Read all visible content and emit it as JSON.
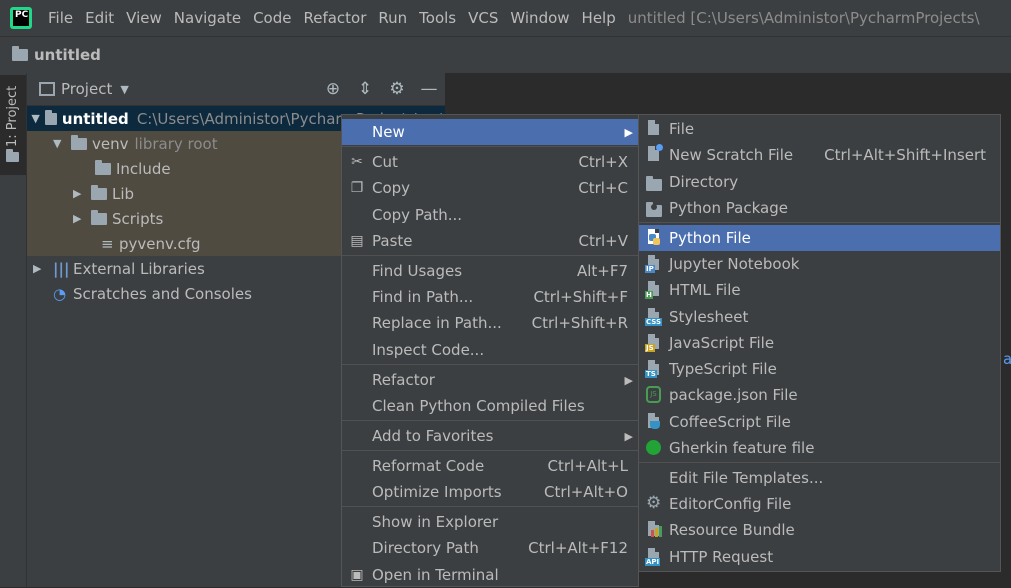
{
  "menubar": {
    "logo_text": "PC",
    "items": [
      "File",
      "Edit",
      "View",
      "Navigate",
      "Code",
      "Refactor",
      "Run",
      "Tools",
      "VCS",
      "Window",
      "Help"
    ],
    "window_title": "untitled [C:\\Users\\Administor\\PycharmProjects\\"
  },
  "navbar": {
    "title": "untitled"
  },
  "left_strip": {
    "tab_label": "1: Project"
  },
  "project_panel": {
    "view_selector": "Project",
    "tree": [
      {
        "label": "untitled",
        "path": "C:\\Users\\Administor\\PycharmProjects\\unt"
      },
      {
        "label": "venv",
        "note": "library root"
      },
      {
        "label": "Include"
      },
      {
        "label": "Lib"
      },
      {
        "label": "Scripts"
      },
      {
        "label": "pyvenv.cfg"
      },
      {
        "label": "External Libraries"
      },
      {
        "label": "Scratches and Consoles"
      }
    ]
  },
  "context_menu": {
    "items": [
      {
        "label": "New",
        "shortcut": ""
      },
      {
        "label": "Cut",
        "shortcut": "Ctrl+X"
      },
      {
        "label": "Copy",
        "shortcut": "Ctrl+C"
      },
      {
        "label": "Copy Path...",
        "shortcut": ""
      },
      {
        "label": "Paste",
        "shortcut": "Ctrl+V"
      },
      {
        "label": "Find Usages",
        "shortcut": "Alt+F7"
      },
      {
        "label": "Find in Path...",
        "shortcut": "Ctrl+Shift+F"
      },
      {
        "label": "Replace in Path...",
        "shortcut": "Ctrl+Shift+R"
      },
      {
        "label": "Inspect Code...",
        "shortcut": ""
      },
      {
        "label": "Refactor",
        "shortcut": ""
      },
      {
        "label": "Clean Python Compiled Files",
        "shortcut": ""
      },
      {
        "label": "Add to Favorites",
        "shortcut": ""
      },
      {
        "label": "Reformat Code",
        "shortcut": "Ctrl+Alt+L"
      },
      {
        "label": "Optimize Imports",
        "shortcut": "Ctrl+Alt+O"
      },
      {
        "label": "Show in Explorer",
        "shortcut": ""
      },
      {
        "label": "Directory Path",
        "shortcut": "Ctrl+Alt+F12"
      },
      {
        "label": "Open in Terminal",
        "shortcut": ""
      }
    ]
  },
  "new_submenu": {
    "items": [
      {
        "label": "File",
        "shortcut": ""
      },
      {
        "label": "New Scratch File",
        "shortcut": "Ctrl+Alt+Shift+Insert"
      },
      {
        "label": "Directory",
        "shortcut": ""
      },
      {
        "label": "Python Package",
        "shortcut": ""
      },
      {
        "label": "Python File",
        "shortcut": ""
      },
      {
        "label": "Jupyter Notebook",
        "shortcut": ""
      },
      {
        "label": "HTML File",
        "shortcut": ""
      },
      {
        "label": "Stylesheet",
        "shortcut": ""
      },
      {
        "label": "JavaScript File",
        "shortcut": ""
      },
      {
        "label": "TypeScript File",
        "shortcut": ""
      },
      {
        "label": "package.json File",
        "shortcut": ""
      },
      {
        "label": "CoffeeScript File",
        "shortcut": ""
      },
      {
        "label": "Gherkin feature file",
        "shortcut": ""
      },
      {
        "label": "Edit File Templates...",
        "shortcut": ""
      },
      {
        "label": "EditorConfig File",
        "shortcut": ""
      },
      {
        "label": "Resource Bundle",
        "shortcut": ""
      },
      {
        "label": "HTTP Request",
        "shortcut": ""
      }
    ],
    "badges": {
      "jupyter": "IP",
      "html": "H",
      "css": "CSS",
      "js": "JS",
      "ts": "TS",
      "api": "API"
    }
  },
  "editor": {
    "edge_glyph": "ai"
  },
  "colors": {
    "selection": "#4b6eaf",
    "tree_selected": "#0d293e",
    "library_bg": "#4f4b41",
    "background": "#3c3f41"
  }
}
